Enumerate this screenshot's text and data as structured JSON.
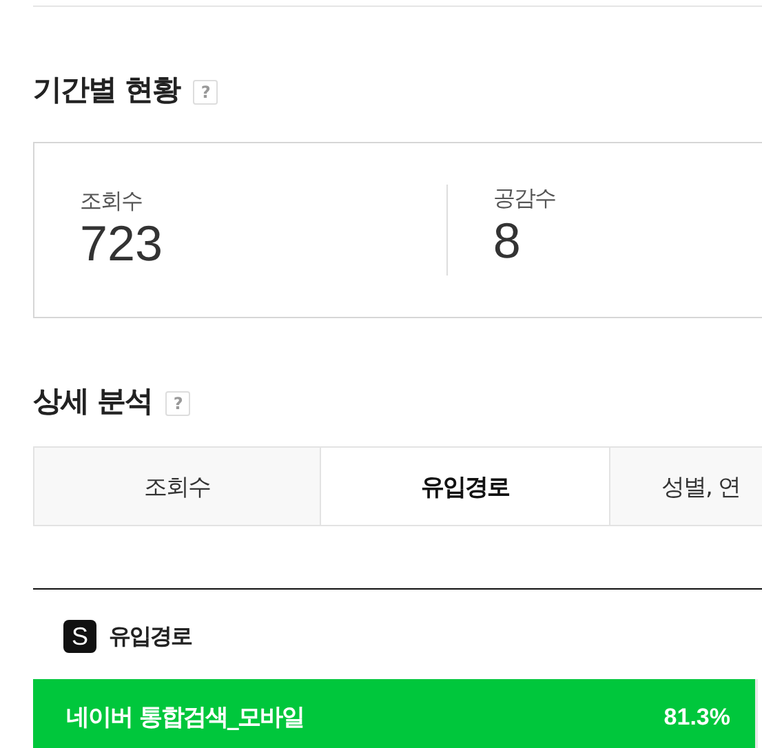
{
  "period_section": {
    "title": "기간별 현황",
    "help": "?"
  },
  "stats": [
    {
      "label": "조회수",
      "value": "723"
    },
    {
      "label": "공감수",
      "value": "8"
    }
  ],
  "detail_section": {
    "title": "상세 분석",
    "help": "?"
  },
  "tabs": [
    {
      "label": "조회수",
      "selected": false
    },
    {
      "label": "유입경로",
      "selected": true
    },
    {
      "label": "성별, 연",
      "selected": false
    }
  ],
  "source": {
    "badge": "S",
    "title": "유입경로"
  },
  "sources": [
    {
      "name": "네이버 통합검색_모바일",
      "share": "81.3%",
      "level": 0.813
    }
  ]
}
